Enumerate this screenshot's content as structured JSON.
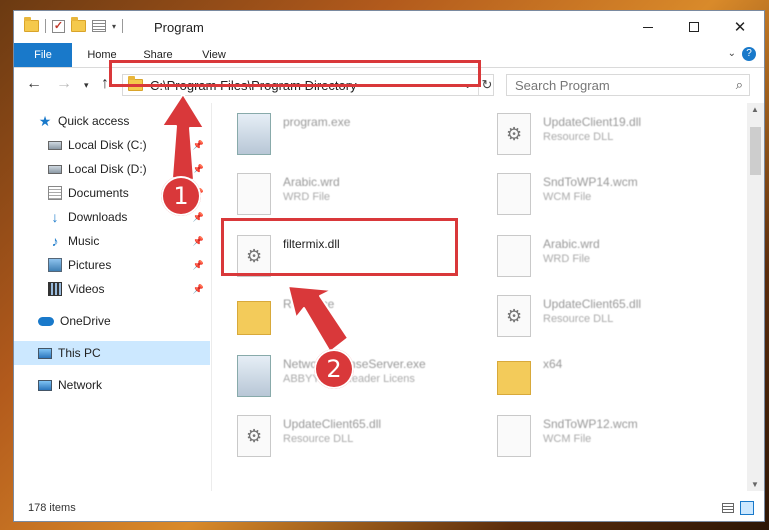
{
  "window": {
    "title": "Program",
    "controls": {
      "minimize": "",
      "maximize": "",
      "close": "✕"
    }
  },
  "ribbon": {
    "tabs": [
      "File",
      "Home",
      "Share",
      "View"
    ],
    "help": "?"
  },
  "address": {
    "path": "C:\\Program Files\\Program Directory",
    "refresh": "↻"
  },
  "search": {
    "placeholder": "Search Program"
  },
  "nav": {
    "items": [
      {
        "label": "Quick access",
        "icon": "star-icon"
      },
      {
        "label": "Local Disk (C:)",
        "icon": "drive-icon",
        "pinned": true
      },
      {
        "label": "Local Disk (D:)",
        "icon": "drive-icon",
        "pinned": true
      },
      {
        "label": "Documents",
        "icon": "documents-icon",
        "pinned": true
      },
      {
        "label": "Downloads",
        "icon": "downloads-icon",
        "pinned": true
      },
      {
        "label": "Music",
        "icon": "music-icon",
        "pinned": true
      },
      {
        "label": "Pictures",
        "icon": "pictures-icon",
        "pinned": true
      },
      {
        "label": "Videos",
        "icon": "videos-icon",
        "pinned": true
      },
      {
        "label": "OneDrive",
        "icon": "onedrive-icon"
      },
      {
        "label": "This PC",
        "icon": "pc-icon",
        "selected": true
      },
      {
        "label": "Network",
        "icon": "network-icon"
      }
    ]
  },
  "files": {
    "left": [
      {
        "name": "program.exe",
        "type": ""
      },
      {
        "name": "Arabic.wrd",
        "type": "WRD File"
      },
      {
        "name": "filtermix.dll",
        "type": ""
      },
      {
        "name": "Resource",
        "type": ""
      },
      {
        "name": "NetworkLicenseServer.exe",
        "type": "ABBYY FineReader Licens"
      },
      {
        "name": "UpdateClient65.dll",
        "type": "Resource DLL"
      }
    ],
    "right": [
      {
        "name": "UpdateClient19.dll",
        "type": "Resource DLL"
      },
      {
        "name": "SndToWP14.wcm",
        "type": "WCM File"
      },
      {
        "name": "Arabic.wrd",
        "type": "WRD File"
      },
      {
        "name": "UpdateClient65.dll",
        "type": "Resource DLL"
      },
      {
        "name": "x64",
        "type": ""
      },
      {
        "name": "SndToWP12.wcm",
        "type": "WCM File"
      }
    ]
  },
  "status": {
    "item_count": "178 items"
  },
  "callouts": {
    "step1": "1",
    "step2": "2",
    "color": "#d9383a"
  }
}
